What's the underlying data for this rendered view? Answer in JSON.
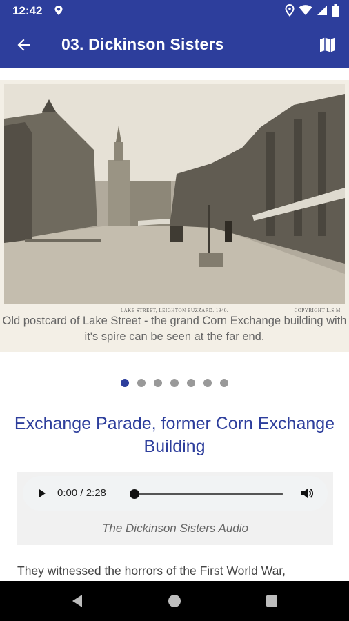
{
  "status_bar": {
    "time": "12:42",
    "icons": [
      "location-icon",
      "wifi-icon",
      "signal-icon",
      "battery-icon"
    ]
  },
  "app_bar": {
    "title": "03. Dickinson Sisters",
    "back_icon": "arrow-back-icon",
    "map_icon": "map-icon"
  },
  "gallery": {
    "image_label": "LAKE STREET, LEIGHTON BUZZARD. 1940.",
    "image_copyright": "COPYRIGHT L.S.M.",
    "caption": "Old postcard of Lake Street - the grand Corn Exchange building with it's spire can be seen at the far end.",
    "page_count": 7,
    "active_index": 0
  },
  "section": {
    "heading": "Exchange Parade, former Corn Exchange Building"
  },
  "audio": {
    "time": "0:00 / 2:28",
    "progress": 0,
    "caption": "The Dickinson Sisters Audio"
  },
  "body": {
    "text": "They witnessed the horrors of the First World War,"
  },
  "colors": {
    "primary": "#2d3e9c",
    "heading": "#2d3e9c",
    "caption_bg": "#f3efe6"
  }
}
